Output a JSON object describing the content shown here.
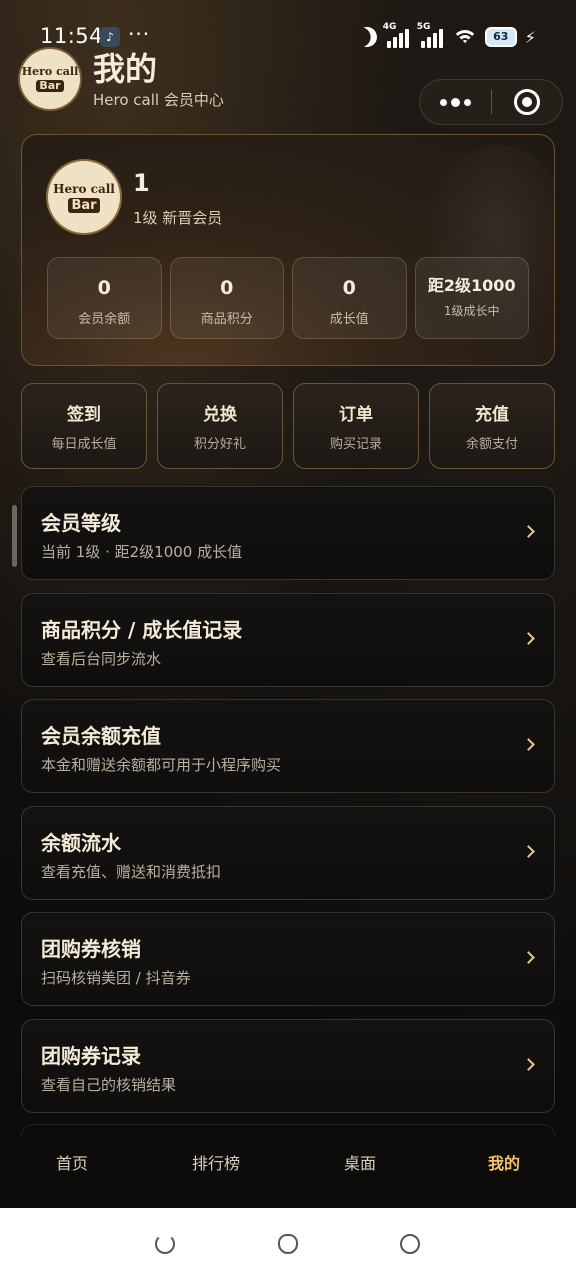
{
  "status_bar": {
    "time": "11:54",
    "app_icon": "tiktok-icon",
    "more": "···",
    "signal1_label": "4G",
    "signal2_label": "5G",
    "wifi_badge": "6",
    "battery": "63",
    "icons": [
      "moon-icon",
      "signal-icon",
      "signal-icon",
      "wifi-icon",
      "battery-icon",
      "charging-icon"
    ]
  },
  "header": {
    "logo_line1": "Hero call",
    "logo_line2": "Bar",
    "title": "我的",
    "subtitle": "Hero call 会员中心"
  },
  "member": {
    "name": "1",
    "level": "1级  新晋会员",
    "stats": [
      {
        "value": "0",
        "label": "会员余额"
      },
      {
        "value": "0",
        "label": "商品积分"
      },
      {
        "value": "0",
        "label": "成长值"
      },
      {
        "value": "距2级1000",
        "label": "1级成长中"
      }
    ]
  },
  "actions": [
    {
      "title": "签到",
      "sub": "每日成长值"
    },
    {
      "title": "兑换",
      "sub": "积分好礼"
    },
    {
      "title": "订单",
      "sub": "购买记录"
    },
    {
      "title": "充值",
      "sub": "余额支付"
    }
  ],
  "menu": [
    {
      "title": "会员等级",
      "sub": "当前 1级 · 距2级1000 成长值"
    },
    {
      "title": "商品积分 / 成长值记录",
      "sub": "查看后台同步流水"
    },
    {
      "title": "会员余额充值",
      "sub": "本金和赠送余额都可用于小程序购买"
    },
    {
      "title": "余额流水",
      "sub": "查看充值、赠送和消费抵扣"
    },
    {
      "title": "团购券核销",
      "sub": "扫码核销美团 / 抖音券"
    },
    {
      "title": "团购券记录",
      "sub": "查看自己的核销结果"
    }
  ],
  "tabs": [
    {
      "label": "首页"
    },
    {
      "label": "排行榜"
    },
    {
      "label": "桌面"
    },
    {
      "label": "我的"
    }
  ],
  "colors": {
    "accent": "#f2c36b",
    "card_border": "#6b5332",
    "background": "#0d0c0b"
  }
}
